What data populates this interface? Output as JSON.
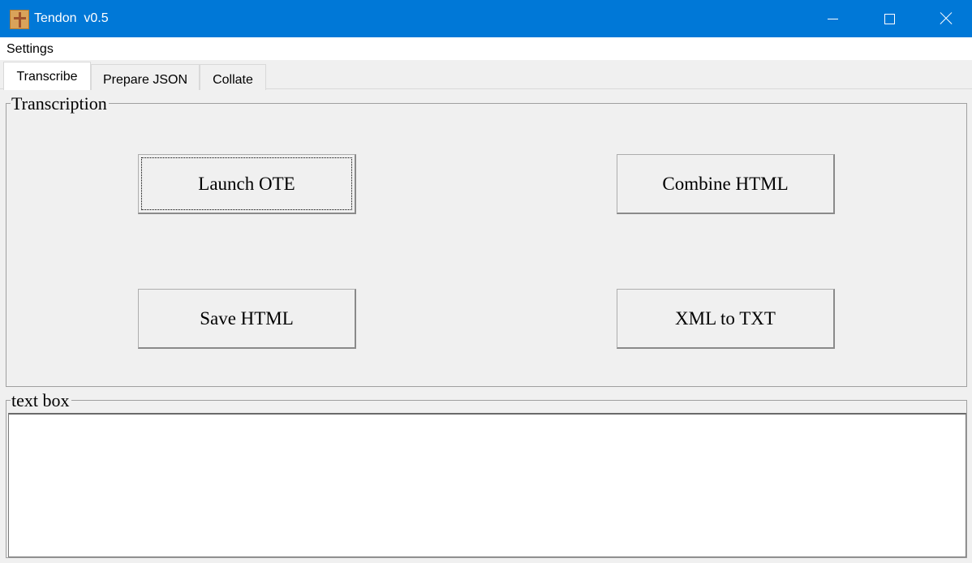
{
  "window": {
    "title": "Tendon  v0.5",
    "icon": "tendon-app-icon"
  },
  "menubar": {
    "items": [
      {
        "label": "Settings"
      }
    ]
  },
  "tabs": [
    {
      "label": "Transcribe",
      "selected": true
    },
    {
      "label": "Prepare JSON",
      "selected": false
    },
    {
      "label": "Collate",
      "selected": false
    }
  ],
  "transcription": {
    "legend": "Transcription",
    "buttons": {
      "launch_ote": "Launch OTE",
      "combine_html": "Combine HTML",
      "save_html": "Save HTML",
      "xml_to_txt": "XML to TXT"
    }
  },
  "textbox": {
    "legend": "text box",
    "value": ""
  },
  "colors": {
    "titlebar": "#0078d7",
    "background": "#f0f0f0"
  }
}
